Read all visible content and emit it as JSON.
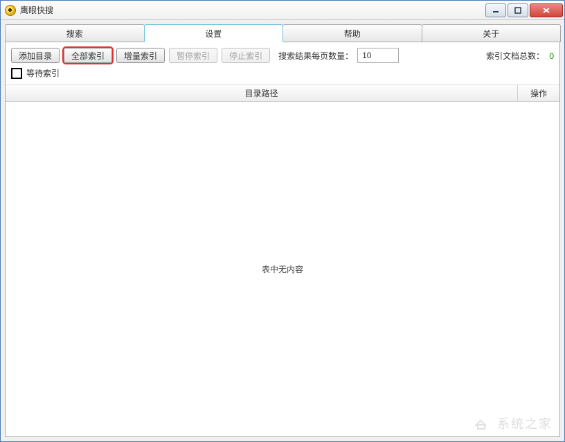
{
  "window": {
    "title": "鹰眼快搜"
  },
  "tabs": {
    "search": "搜索",
    "settings": "设置",
    "help": "帮助",
    "about": "关于",
    "active": "settings"
  },
  "toolbar": {
    "add_dir": "添加目录",
    "full_index": "全部索引",
    "inc_index": "增量索引",
    "pause_index": "暂停索引",
    "stop_index": "停止索引",
    "per_page_label": "搜索结果每页数量：",
    "per_page_value": "10",
    "doc_count_label": "索引文档总数：",
    "doc_count_value": "0"
  },
  "wait": {
    "label": "等待索引"
  },
  "table": {
    "col_path": "目录路径",
    "col_op": "操作",
    "empty": "表中无内容"
  },
  "watermark": {
    "text": "系统之家"
  }
}
